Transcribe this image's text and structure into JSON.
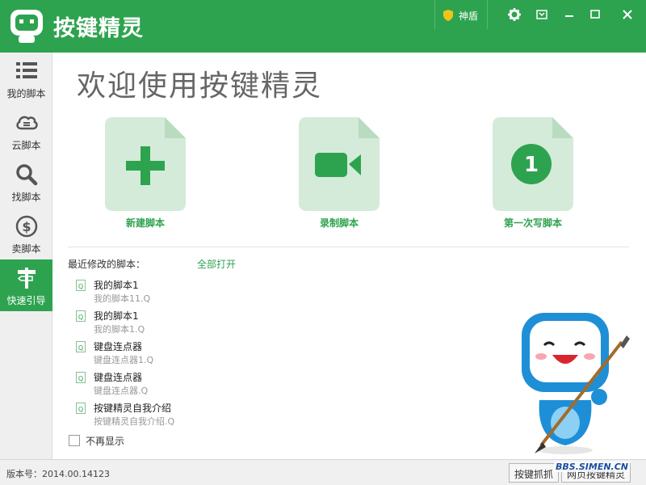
{
  "app": {
    "title": "按键精灵",
    "shield_label": "神盾",
    "brand_color": "#2ea34f"
  },
  "titlebar": {
    "buttons": [
      "gear-icon",
      "skin-icon",
      "minimize-icon",
      "maximize-icon",
      "close-icon"
    ]
  },
  "sidebar": {
    "items": [
      {
        "label": "我的脚本",
        "icon": "list-icon"
      },
      {
        "label": "云脚本",
        "icon": "cloud-icon"
      },
      {
        "label": "找脚本",
        "icon": "search-icon"
      },
      {
        "label": "卖脚本",
        "icon": "dollar-icon"
      },
      {
        "label": "快速引导",
        "icon": "signpost-icon",
        "active": true
      }
    ]
  },
  "main": {
    "welcome": "欢迎使用按键精灵",
    "cards": [
      {
        "label": "新建脚本",
        "icon": "plus-icon"
      },
      {
        "label": "录制脚本",
        "icon": "video-camera-icon"
      },
      {
        "label": "第一次写脚本",
        "icon": "number-one-icon",
        "badge": "1"
      }
    ],
    "recent_title": "最近修改的脚本：",
    "open_all": "全部打开",
    "recent": [
      {
        "name": "我的脚本1",
        "file": "我的脚本11.Q"
      },
      {
        "name": "我的脚本1",
        "file": "我的脚本1.Q"
      },
      {
        "name": "键盘连点器",
        "file": "键盘连点器1.Q"
      },
      {
        "name": "键盘连点器",
        "file": "键盘连点器.Q"
      },
      {
        "name": "按键精灵自我介绍",
        "file": "按键精灵自我介绍.Q"
      }
    ],
    "no_show": "不再显示"
  },
  "statusbar": {
    "version": "版本号：2014.00.14123",
    "btn1": "按键抓抓",
    "btn2": "网页按键精灵",
    "watermark": "BBS.SIMEN.CN"
  }
}
